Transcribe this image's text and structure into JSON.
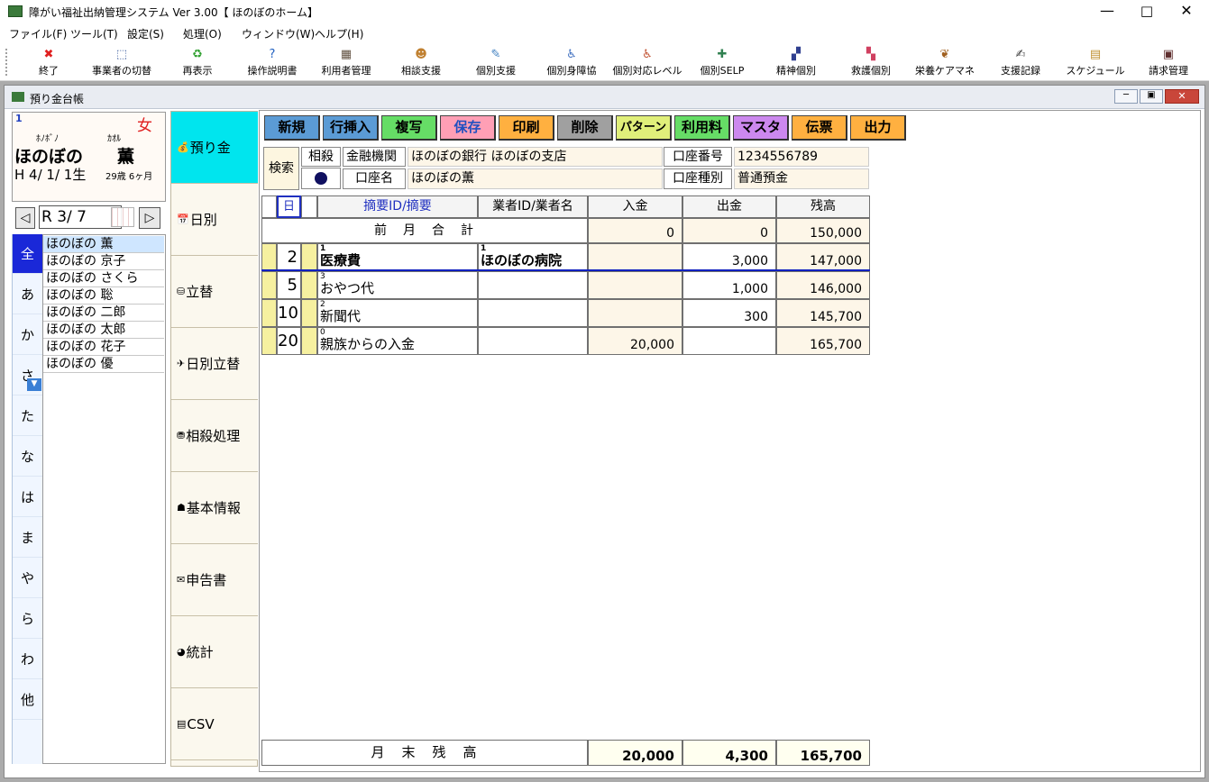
{
  "window": {
    "title": "障がい福祉出納管理システム Ver 3.00【 ほのぼのホーム】"
  },
  "menu": [
    "ファイル(F)",
    "ツール(T)",
    "設定(S)",
    "処理(O)",
    "ウィンドウ(W)",
    "ヘルプ(H)"
  ],
  "toolbar": [
    {
      "label": "終了",
      "icon": "✖",
      "color": "#e02020"
    },
    {
      "label": "事業者の切替",
      "icon": "⬚",
      "color": "#4060a0"
    },
    {
      "label": "再表示",
      "icon": "♻",
      "color": "#30a030"
    },
    {
      "label": "操作説明書",
      "icon": "?",
      "color": "#2060c0"
    },
    {
      "label": "利用者管理",
      "icon": "▦",
      "color": "#605040"
    },
    {
      "label": "相談支援",
      "icon": "☻",
      "color": "#c08030"
    },
    {
      "label": "個別支援",
      "icon": "✎",
      "color": "#4080c0"
    },
    {
      "label": "個別身障協",
      "icon": "♿",
      "color": "#4070c0"
    },
    {
      "label": "個別対応レベル",
      "icon": "♿",
      "color": "#c05030"
    },
    {
      "label": "個別SELP",
      "icon": "✚",
      "color": "#308050"
    },
    {
      "label": "精神個別",
      "icon": "▞",
      "color": "#304090"
    },
    {
      "label": "救護個別",
      "icon": "▚",
      "color": "#d04060"
    },
    {
      "label": "栄養ケアマネ",
      "icon": "❦",
      "color": "#a06020"
    },
    {
      "label": "支援記録",
      "icon": "✍",
      "color": "#404040"
    },
    {
      "label": "スケジュール",
      "icon": "▤",
      "color": "#c09030"
    },
    {
      "label": "請求管理",
      "icon": "▣",
      "color": "#603030"
    }
  ],
  "child": {
    "title": "預り金台帳"
  },
  "profile": {
    "id": "1",
    "sex": "女",
    "kana_last": "ﾎﾉﾎﾞﾉ",
    "kana_first": "ｶｵﾙ",
    "last": "ほのぼの",
    "first": "薫",
    "birth": "H 4/ 1/ 1生",
    "age": "29歳 6ヶ月"
  },
  "nav": {
    "value": "R 3/ 7"
  },
  "kana_tabs": [
    "全",
    "あ",
    "か",
    "さ",
    "た",
    "な",
    "は",
    "ま",
    "や",
    "ら",
    "わ",
    "他"
  ],
  "users": [
    "ほのぼの 薫",
    "ほのぼの 京子",
    "ほのぼの さくら",
    "ほのぼの 聡",
    "ほのぼの 二郎",
    "ほのぼの 太郎",
    "ほのぼの 花子",
    "ほのぼの 優"
  ],
  "side_tabs": [
    {
      "label": "預り金",
      "icon": "💰"
    },
    {
      "label": "日別",
      "icon": "📅"
    },
    {
      "label": "立替",
      "icon": "⛁"
    },
    {
      "label": "日別立替",
      "icon": "✈"
    },
    {
      "label": "相殺処理",
      "icon": "⛃"
    },
    {
      "label": "基本情報",
      "icon": "☗"
    },
    {
      "label": "申告書",
      "icon": "✉"
    },
    {
      "label": "統計",
      "icon": "◕"
    },
    {
      "label": "CSV",
      "icon": "▤"
    }
  ],
  "actions": [
    {
      "label": "新規",
      "bg": "#5b9bd5",
      "w": 62
    },
    {
      "label": "行挿入",
      "bg": "#5b9bd5",
      "w": 62
    },
    {
      "label": "複写",
      "bg": "#66dd66",
      "w": 62
    },
    {
      "label": "保存",
      "bg": "#ff9fb5",
      "w": 62,
      "color": "#2050c0"
    },
    {
      "label": "印刷",
      "bg": "#ffb040",
      "w": 62
    },
    {
      "label": "削除",
      "bg": "#a0a0a0",
      "w": 62
    },
    {
      "label": "パターン",
      "bg": "#e0ef7a",
      "w": 62,
      "fs": 13
    },
    {
      "label": "利用料",
      "bg": "#66dd66",
      "w": 62
    },
    {
      "label": "マスタ",
      "bg": "#cc88ee",
      "w": 62
    },
    {
      "label": "伝票",
      "bg": "#ffb040",
      "w": 62
    },
    {
      "label": "出力",
      "bg": "#ffb040",
      "w": 62
    }
  ],
  "search": {
    "label": "検索",
    "offset": "相殺",
    "bank_label": "金融機関",
    "bank": "ほのぼの銀行 ほのぼの支店",
    "accname_label": "口座名",
    "accname": "ほのぼの薫",
    "accno_label": "口座番号",
    "accno": "1234556789",
    "acctype_label": "口座種別",
    "acctype": "普通預金"
  },
  "table": {
    "headers": {
      "day": "日",
      "item": "摘要ID/摘要",
      "vendor": "業者ID/業者名",
      "in": "入金",
      "out": "出金",
      "bal": "残高"
    },
    "prev": {
      "label": "前　月　合　計",
      "in": "0",
      "out": "0",
      "bal": "150,000"
    },
    "rows": [
      {
        "day": "2",
        "item_id": "1",
        "item": "医療費",
        "vendor_id": "1",
        "vendor": "ほのぼの病院",
        "in": "",
        "out": "3,000",
        "bal": "147,000",
        "bold": true
      },
      {
        "day": "5",
        "item_id": "3",
        "item": "おやつ代",
        "vendor_id": "",
        "vendor": "",
        "in": "",
        "out": "1,000",
        "bal": "146,000"
      },
      {
        "day": "10",
        "item_id": "2",
        "item": "新聞代",
        "vendor_id": "",
        "vendor": "",
        "in": "",
        "out": "300",
        "bal": "145,700"
      },
      {
        "day": "20",
        "item_id": "0",
        "item": "親族からの入金",
        "vendor_id": "",
        "vendor": "",
        "in": "20,000",
        "out": "",
        "bal": "165,700"
      }
    ],
    "footer": {
      "label": "月　末　残　高",
      "in": "20,000",
      "out": "4,300",
      "bal": "165,700"
    }
  }
}
